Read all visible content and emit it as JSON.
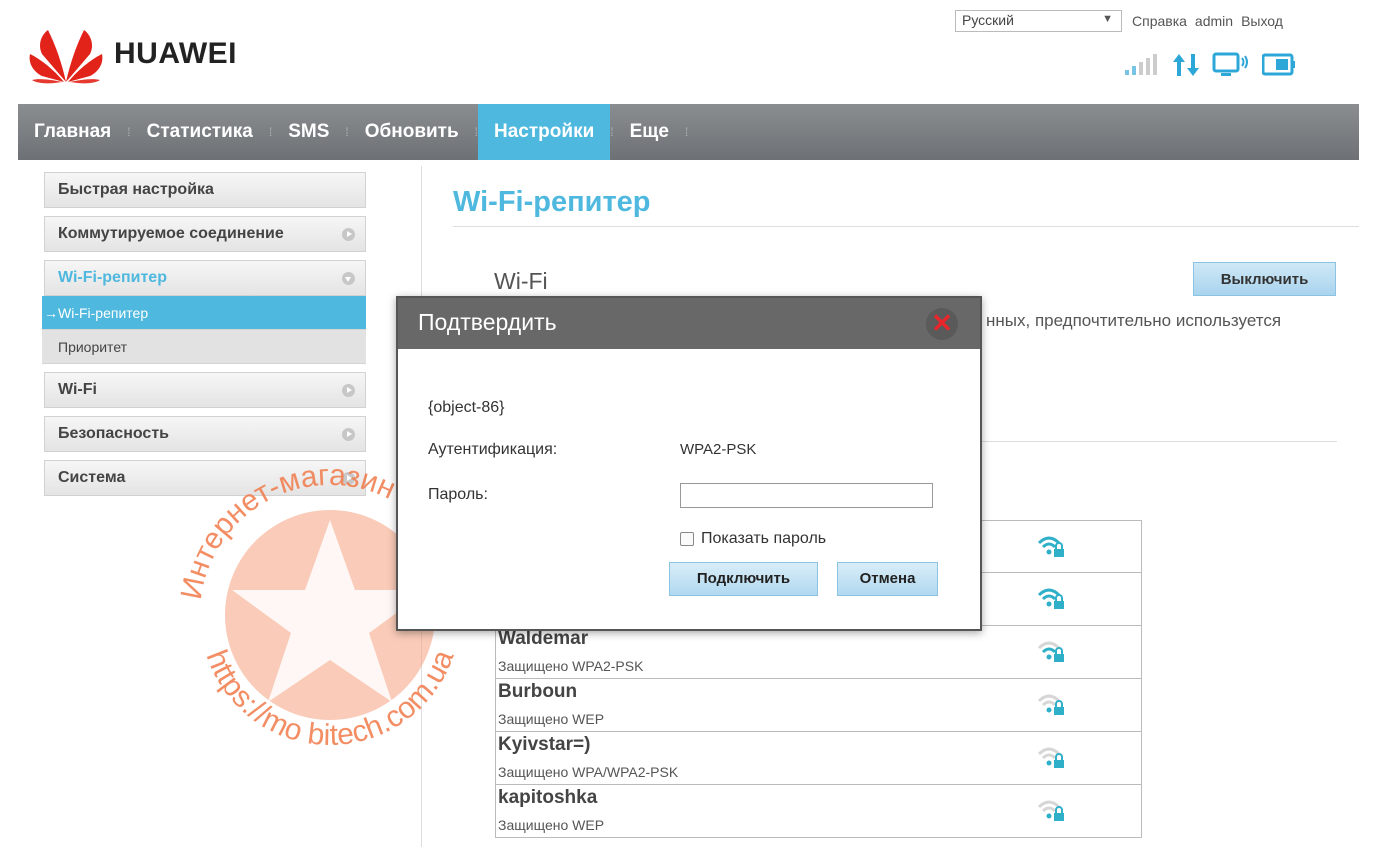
{
  "header": {
    "brand": "HUAWEI",
    "language": "Русский",
    "links": {
      "help": "Справка",
      "user": "admin",
      "logout": "Выход"
    }
  },
  "nav": {
    "items": [
      "Главная",
      "Статистика",
      "SMS",
      "Обновить",
      "Настройки",
      "Еще"
    ],
    "active": "Настройки"
  },
  "sidebar": {
    "items": [
      {
        "label": "Быстрая настройка"
      },
      {
        "label": "Коммутируемое соединение"
      },
      {
        "label": "Wi-Fi-репитер"
      },
      {
        "label": "Wi-Fi"
      },
      {
        "label": "Безопасность"
      },
      {
        "label": "Система"
      }
    ],
    "sub_items": [
      "→Wi-Fi-репитер",
      "Приоритет"
    ]
  },
  "main": {
    "title": "Wi-Fi-репитер",
    "wifi_label": "Wi-Fi",
    "off_button": "Выключить",
    "description_fragment": "нных, предпочтительно используется"
  },
  "networks": [
    {
      "name": "Waldemar",
      "security": "Защищено WPA2-PSK"
    },
    {
      "name": "Burboun",
      "security": "Защищено WEP"
    },
    {
      "name": "Kyivstar=)",
      "security": "Защищено WPA/WPA2-PSK"
    },
    {
      "name": "kapitoshka",
      "security": "Защищено WEP"
    }
  ],
  "modal": {
    "title": "Подтвердить",
    "object_text": "{object-86}",
    "auth_label": "Аутентификация:",
    "auth_value": "WPA2-PSK",
    "password_label": "Пароль:",
    "password_value": "",
    "show_password_label": "Показать пароль",
    "connect_button": "Подключить",
    "cancel_button": "Отмена"
  },
  "watermark": {
    "top_text": "Интернет-магазин Мобитек",
    "bottom_text": "https://mo bitech.com.ua"
  },
  "colors": {
    "accent": "#4fb8de",
    "nav_bg": "#7b7f83",
    "brand_red": "#e8262b",
    "watermark": "#f07a4a"
  },
  "icons": [
    "signal-icon",
    "data-arrows-icon",
    "monitor-icon",
    "battery-icon",
    "wifi-lock-icon",
    "close-icon"
  ]
}
